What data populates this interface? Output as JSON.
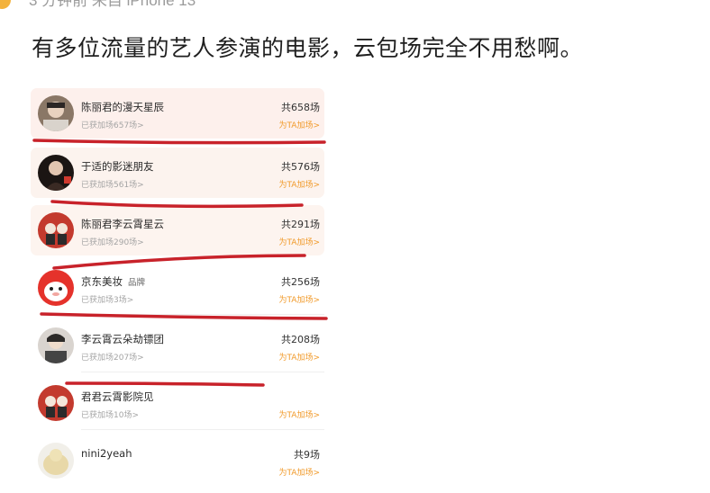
{
  "post": {
    "top_line": "3 分钟前  来自 iPhone 13",
    "text": "有多位流量的艺人参演的电影，云包场完全不用愁啊。"
  },
  "list": [
    {
      "name": "陈丽君的漫天星辰",
      "badge": "",
      "sub": "已获加场657场>",
      "total": "共658场",
      "add": "为TA加场>"
    },
    {
      "name": "于适的影迷朋友",
      "badge": "",
      "sub": "已获加场561场>",
      "total": "共576场",
      "add": "为TA加场>"
    },
    {
      "name": "陈丽君李云霄星云",
      "badge": "",
      "sub": "已获加场290场>",
      "total": "共291场",
      "add": "为TA加场>"
    },
    {
      "name": "京东美妆",
      "badge": "品牌",
      "sub": "已获加场3场>",
      "total": "共256场",
      "add": "为TA加场>"
    },
    {
      "name": "李云霄云朵劫镖团",
      "badge": "",
      "sub": "已获加场207场>",
      "total": "共208场",
      "add": "为TA加场>"
    },
    {
      "name": "君君云霄影院见",
      "badge": "",
      "sub": "已获加场10场>",
      "total": "",
      "add": "为TA加场>"
    },
    {
      "name": "nini2yeah",
      "badge": "",
      "sub": "",
      "total": "共9场",
      "add": "为TA加场>"
    }
  ],
  "colors": {
    "annotation_red": "#c8222a",
    "add_link": "#f19a2a",
    "row_highlight": "#fdf1ea"
  }
}
